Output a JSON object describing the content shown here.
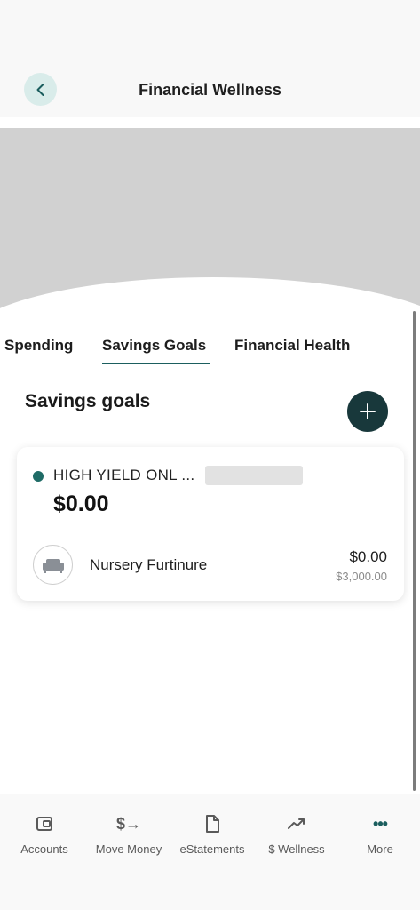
{
  "header": {
    "title": "Financial Wellness"
  },
  "tabs": [
    {
      "label": "Spending"
    },
    {
      "label": "Savings Goals",
      "active": true
    },
    {
      "label": "Financial Health"
    }
  ],
  "section": {
    "title": "Savings goals"
  },
  "account_card": {
    "account_name": "HIGH YIELD ONL ...",
    "balance": "$0.00",
    "goal": {
      "name": "Nursery Furtinure",
      "amount": "$0.00",
      "target": "$3,000.00"
    }
  },
  "bottom_nav": [
    {
      "label": "Accounts",
      "icon": "wallet-icon"
    },
    {
      "label": "Move Money",
      "icon": "dollar-transfer-icon",
      "glyph": "$→"
    },
    {
      "label": "eStatements",
      "icon": "document-icon"
    },
    {
      "label": "$ Wellness",
      "icon": "trend-up-icon"
    },
    {
      "label": "More",
      "icon": "more-dots-icon",
      "glyph": "•••"
    }
  ],
  "colors": {
    "accent": "#1b5e5e",
    "add_button": "#18383b",
    "status_dot": "#1f6b66",
    "back_button_bg": "#d9ecea"
  }
}
